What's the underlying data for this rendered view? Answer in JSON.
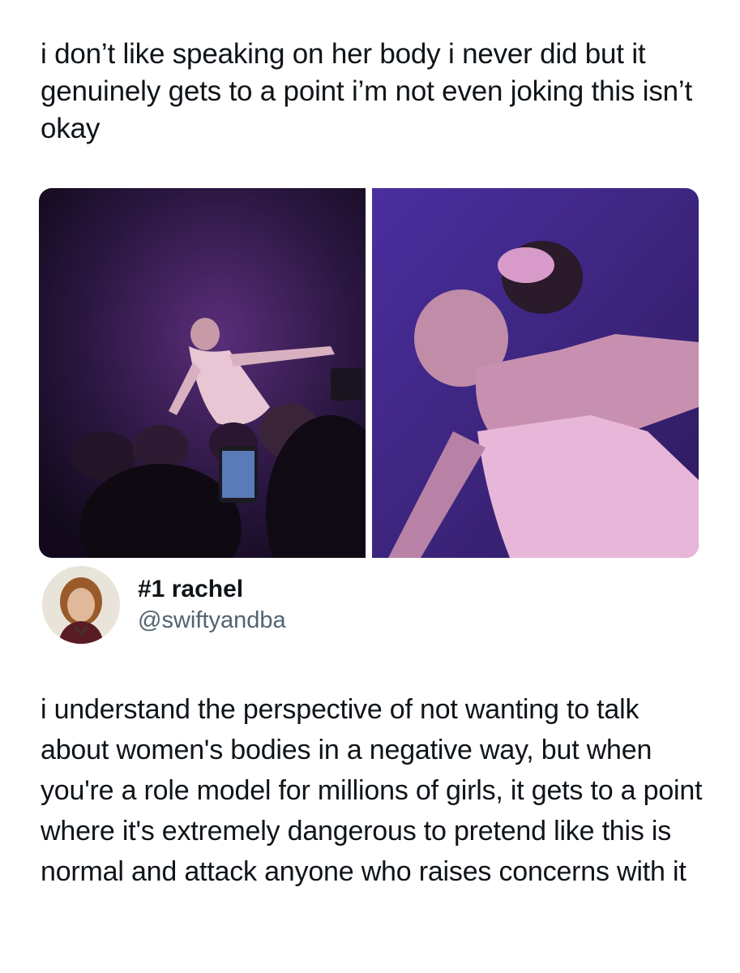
{
  "quoted_post": {
    "text": "i don’t like speaking on her body i never did but it genuinely gets to a point i’m not even joking this isn’t okay"
  },
  "media": [
    {
      "name": "concert-photo-crowd"
    },
    {
      "name": "concert-photo-closeup"
    }
  ],
  "author": {
    "display_name": "#1 rachel",
    "handle": "@swiftyandba"
  },
  "post": {
    "text": "i understand the perspective of not wanting to talk about women's bodies in a negative way, but when you're a role model for millions of girls, it gets to a point where it's extremely dangerous to pretend like this is normal and attack anyone who raises concerns with it"
  },
  "colors": {
    "text_primary": "#0f1419",
    "text_secondary": "#536471",
    "background": "#ffffff",
    "photo_purple": "#4b2a8a"
  }
}
